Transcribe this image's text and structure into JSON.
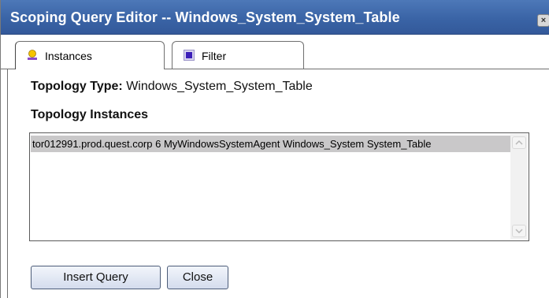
{
  "window": {
    "title": "Scoping Query Editor -- Windows_System_System_Table",
    "close_glyph": "×"
  },
  "tabs": [
    {
      "label": "Instances",
      "icon": "instances-icon",
      "selected": true
    },
    {
      "label": "Filter",
      "icon": "filter-icon",
      "selected": false
    }
  ],
  "topology": {
    "type_label": "Topology Type:",
    "type_value": "Windows_System_System_Table",
    "instances_heading": "Topology Instances"
  },
  "instances_list": {
    "items": [
      "tor012991.prod.quest.corp 6 MyWindowsSystemAgent Windows_System System_Table"
    ]
  },
  "buttons": {
    "insert_query": "Insert Query",
    "close": "Close"
  },
  "colors": {
    "titlebar": "#3a64a6",
    "selected_row": "#c9c8c9",
    "filter_icon": "#3b1fb8"
  }
}
